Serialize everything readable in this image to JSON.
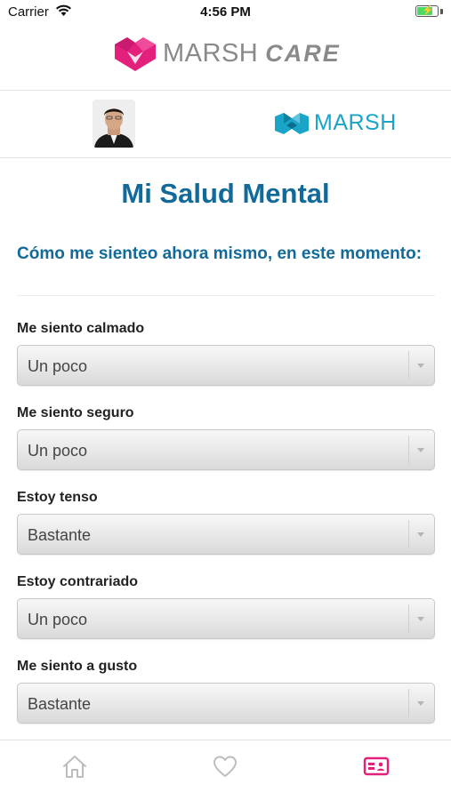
{
  "status_bar": {
    "carrier": "Carrier",
    "time": "4:56 PM",
    "battery_charging": true
  },
  "header": {
    "brand_primary": "MARSH",
    "brand_secondary": "CARE",
    "logo_colors": {
      "primary": "#e3217d",
      "secondary": "#c91a6f"
    }
  },
  "user_bar": {
    "avatar_icon": "user-photo",
    "partner_logo_text": "MARSH",
    "partner_color": "#1aa5c8"
  },
  "main": {
    "title": "Mi Salud Mental",
    "question": "Cómo me sienteo ahora mismo, en este momento:",
    "fields": [
      {
        "label": "Me siento calmado",
        "value": "Un poco"
      },
      {
        "label": "Me siento seguro",
        "value": "Un poco"
      },
      {
        "label": "Estoy tenso",
        "value": "Bastante"
      },
      {
        "label": "Estoy contrariado",
        "value": "Un poco"
      },
      {
        "label": "Me siento a gusto",
        "value": "Bastante"
      }
    ]
  },
  "tab_bar": {
    "tabs": [
      {
        "icon": "home-icon",
        "active": false
      },
      {
        "icon": "heart-icon",
        "active": false
      },
      {
        "icon": "id-card-icon",
        "active": true
      }
    ],
    "active_color": "#e3217d",
    "inactive_color": "#bdbdbd"
  },
  "colors": {
    "title": "#116a99",
    "accent": "#e3217d"
  }
}
